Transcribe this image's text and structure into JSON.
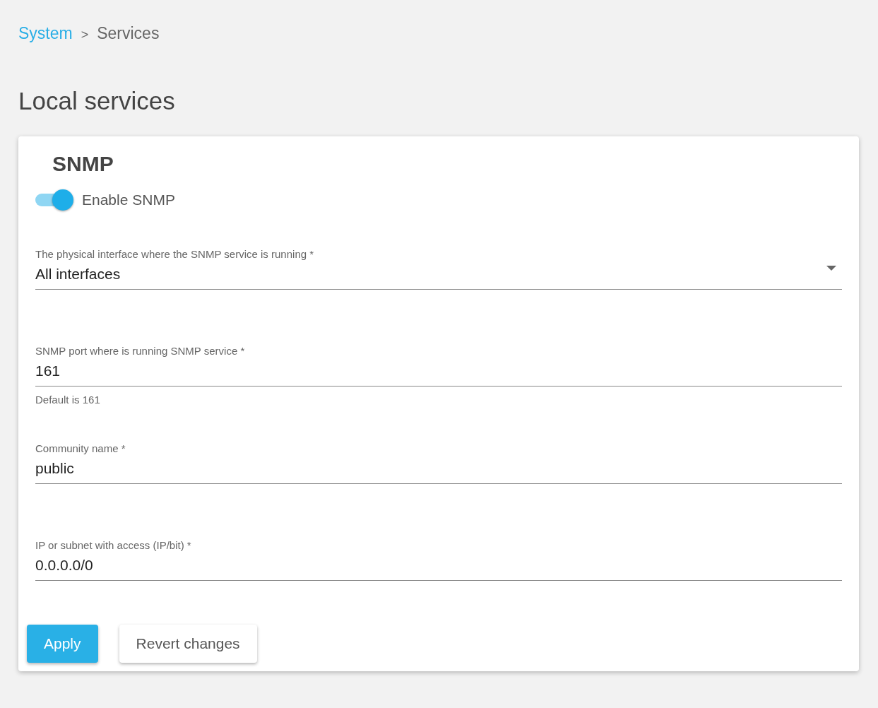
{
  "breadcrumb": {
    "link": "System",
    "separator": ">",
    "current": "Services"
  },
  "page_title": "Local services",
  "card": {
    "title": "SNMP",
    "toggle": {
      "label": "Enable SNMP",
      "on": true
    },
    "fields": [
      {
        "kind": "select",
        "label": "The physical interface where the SNMP service is running *",
        "value": "All interfaces"
      },
      {
        "kind": "text",
        "label": "SNMP port where is running SNMP service *",
        "value": "161",
        "helper": "Default is 161"
      },
      {
        "kind": "text",
        "label": "Community name *",
        "value": "public"
      },
      {
        "kind": "text",
        "label": "IP or subnet with access (IP/bit) *",
        "value": "0.0.0.0/0"
      }
    ],
    "buttons": [
      {
        "kind": "primary",
        "label": "Apply"
      },
      {
        "kind": "secondary",
        "label": "Revert changes"
      }
    ]
  }
}
